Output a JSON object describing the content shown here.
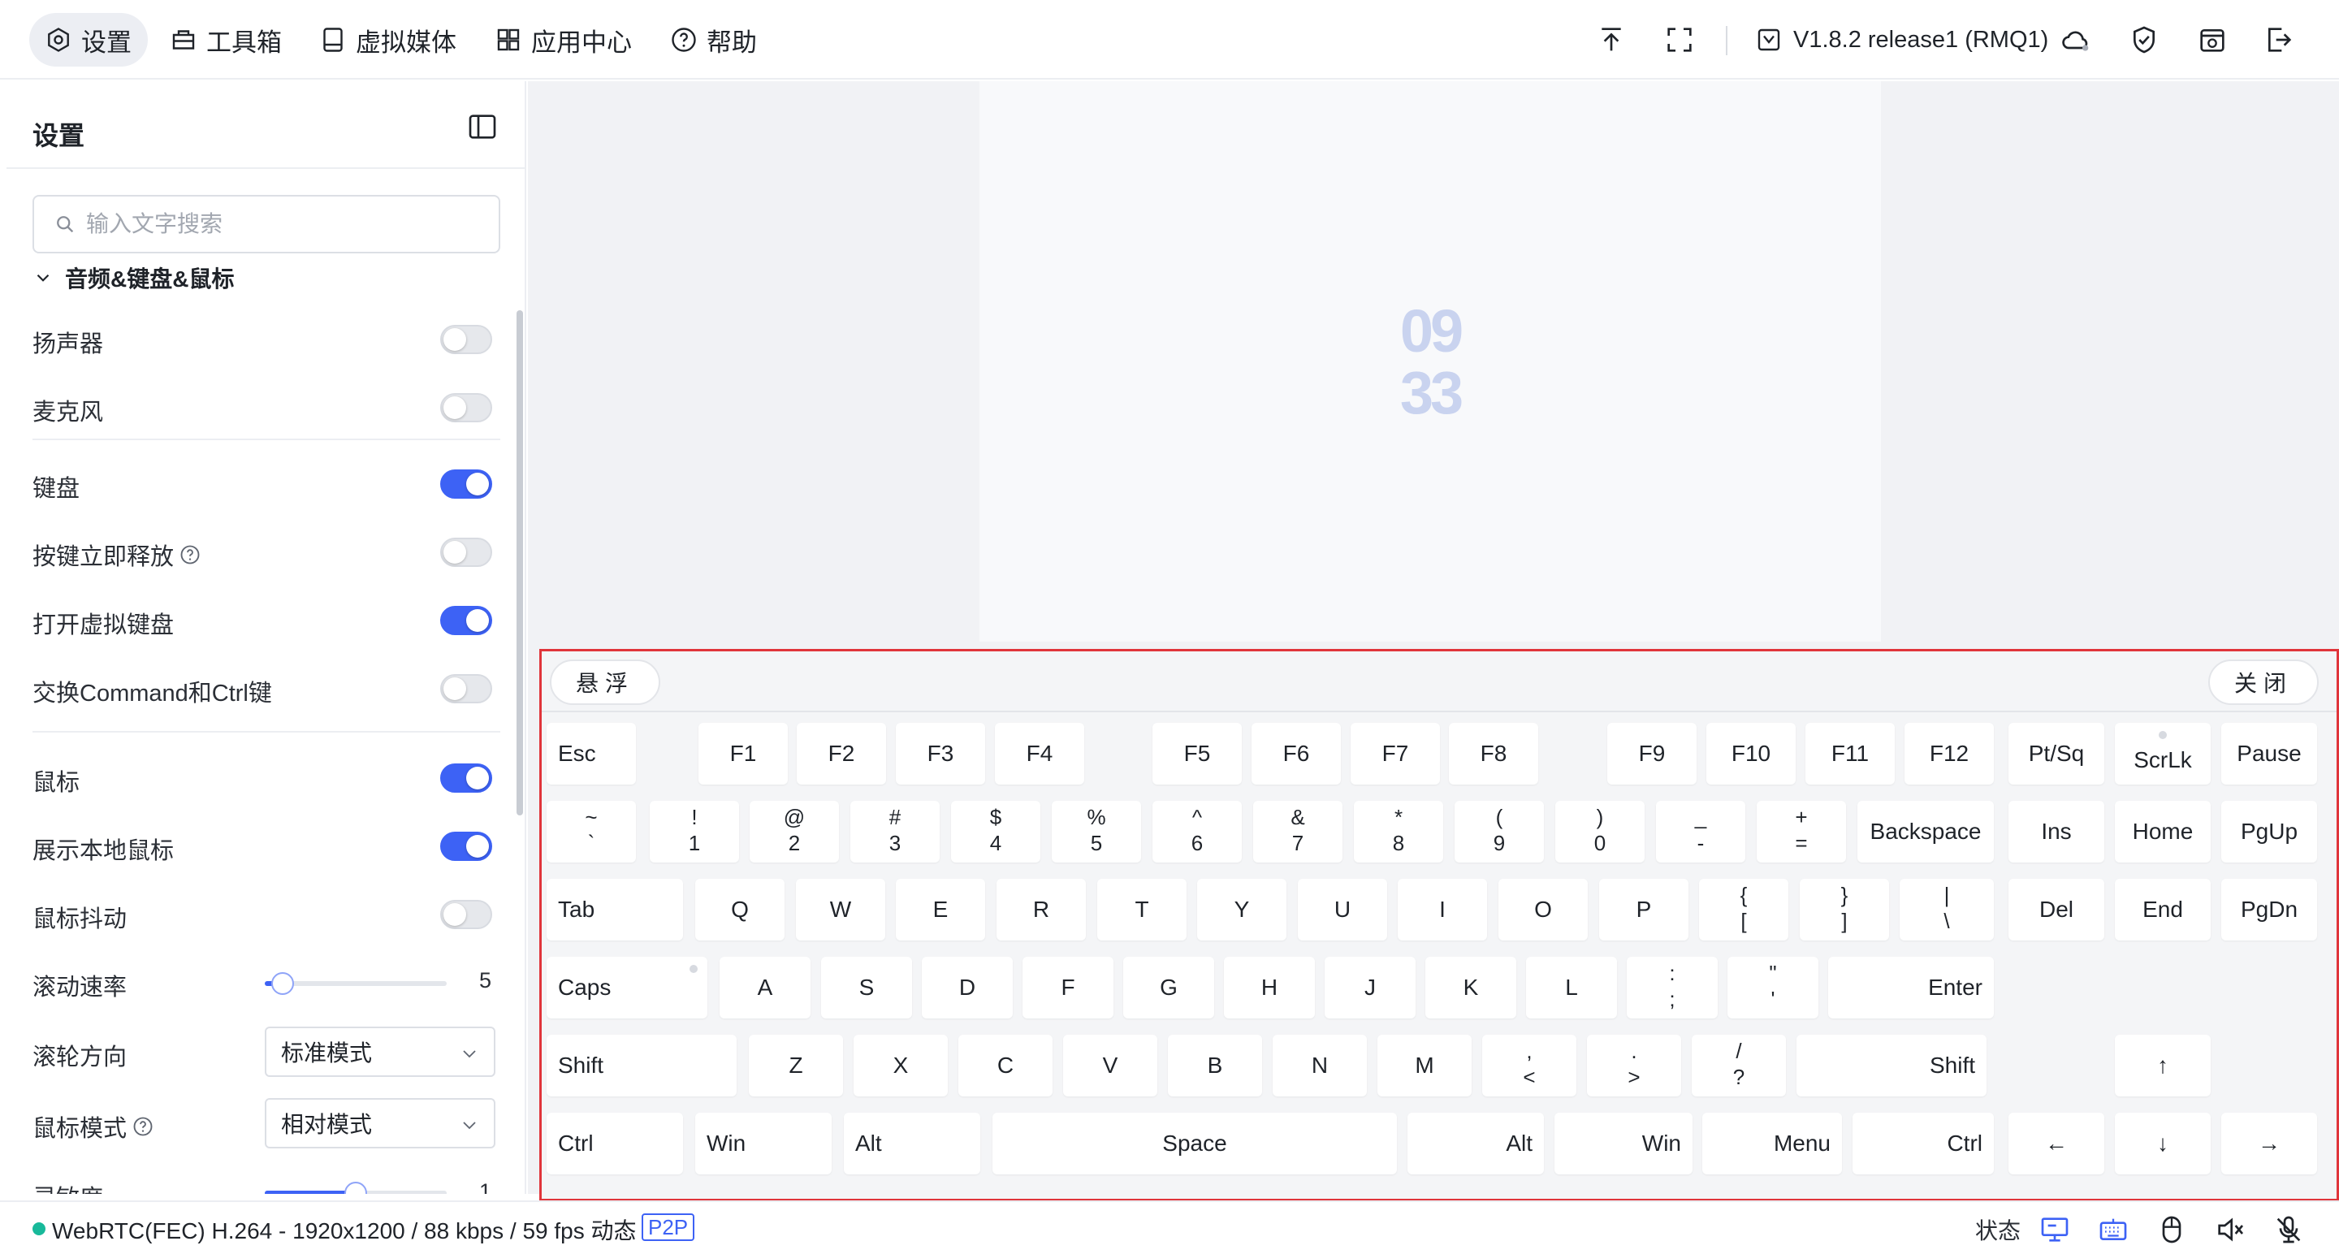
{
  "topbar": {
    "nav": [
      {
        "label": "设置",
        "icon": "gear-icon",
        "active": true
      },
      {
        "label": "工具箱",
        "icon": "toolbox-icon",
        "active": false
      },
      {
        "label": "虚拟媒体",
        "icon": "disk-icon",
        "active": false
      },
      {
        "label": "应用中心",
        "icon": "apps-icon",
        "active": false
      },
      {
        "label": "帮助",
        "icon": "help-icon",
        "active": false
      }
    ],
    "version": "V1.8.2 release1 (RMQ1)",
    "right_icons": [
      "upload-icon",
      "fullscreen-icon",
      "cloud-icon",
      "shield-check-icon",
      "window-icon",
      "logout-icon"
    ]
  },
  "sidebar": {
    "title": "设置",
    "search_placeholder": "输入文字搜索",
    "section": "音频&键盘&鼠标",
    "rows": [
      {
        "label": "扬声器",
        "type": "toggle",
        "on": false
      },
      {
        "label": "麦克风",
        "type": "toggle",
        "on": false
      },
      {
        "label": "键盘",
        "type": "toggle",
        "on": true
      },
      {
        "label": "按键立即释放",
        "type": "toggle",
        "on": false,
        "help": true
      },
      {
        "label": "打开虚拟键盘",
        "type": "toggle",
        "on": true
      },
      {
        "label": "交换Command和Ctrl键",
        "type": "toggle",
        "on": false
      },
      {
        "label": "鼠标",
        "type": "toggle",
        "on": true
      },
      {
        "label": "展示本地鼠标",
        "type": "toggle",
        "on": true
      },
      {
        "label": "鼠标抖动",
        "type": "toggle",
        "on": false
      },
      {
        "label": "滚动速率",
        "type": "slider",
        "value": "5",
        "fraction": 0.1
      },
      {
        "label": "滚轮方向",
        "type": "select",
        "value": "标准模式"
      },
      {
        "label": "鼠标模式",
        "type": "select",
        "value": "相对模式",
        "help": true
      },
      {
        "label": "灵敏度",
        "type": "slider",
        "value": "1",
        "fraction": 0.5
      }
    ]
  },
  "screen": {
    "clock_hour": "09",
    "clock_minute": "33"
  },
  "keyboard": {
    "float_label": "悬浮",
    "close_label": "关闭",
    "keys": [
      {
        "label": "Esc"
      },
      {
        "label": "F1"
      },
      {
        "label": "F2"
      },
      {
        "label": "F3"
      },
      {
        "label": "F4"
      },
      {
        "label": "F5"
      },
      {
        "label": "F6"
      },
      {
        "label": "F7"
      },
      {
        "label": "F8"
      },
      {
        "label": "F9"
      },
      {
        "label": "F10"
      },
      {
        "label": "F11"
      },
      {
        "label": "F12"
      },
      {
        "label": "Pt/Sq"
      },
      {
        "label": "ScrLk"
      },
      {
        "label": "Pause"
      },
      {
        "top": "~",
        "bot": "`"
      },
      {
        "top": "!",
        "bot": "1"
      },
      {
        "top": "@",
        "bot": "2"
      },
      {
        "top": "#",
        "bot": "3"
      },
      {
        "top": "$",
        "bot": "4"
      },
      {
        "top": "%",
        "bot": "5"
      },
      {
        "top": "^",
        "bot": "6"
      },
      {
        "top": "&",
        "bot": "7"
      },
      {
        "top": "*",
        "bot": "8"
      },
      {
        "top": "(",
        "bot": "9"
      },
      {
        "top": ")",
        "bot": "0"
      },
      {
        "top": "_",
        "bot": "-"
      },
      {
        "top": "+",
        "bot": "="
      },
      {
        "label": "Backspace"
      },
      {
        "label": "Ins"
      },
      {
        "label": "Home"
      },
      {
        "label": "PgUp"
      },
      {
        "label": "Tab"
      },
      {
        "label": "Q"
      },
      {
        "label": "W"
      },
      {
        "label": "E"
      },
      {
        "label": "R"
      },
      {
        "label": "T"
      },
      {
        "label": "Y"
      },
      {
        "label": "U"
      },
      {
        "label": "I"
      },
      {
        "label": "O"
      },
      {
        "label": "P"
      },
      {
        "top": "{",
        "bot": "["
      },
      {
        "top": "}",
        "bot": "]"
      },
      {
        "top": "|",
        "bot": "\\"
      },
      {
        "label": "Del"
      },
      {
        "label": "End"
      },
      {
        "label": "PgDn"
      },
      {
        "label": "Caps"
      },
      {
        "label": "A"
      },
      {
        "label": "S"
      },
      {
        "label": "D"
      },
      {
        "label": "F"
      },
      {
        "label": "G"
      },
      {
        "label": "H"
      },
      {
        "label": "J"
      },
      {
        "label": "K"
      },
      {
        "label": "L"
      },
      {
        "top": ":",
        "bot": ";"
      },
      {
        "top": "\"",
        "bot": "'"
      },
      {
        "label": "Enter"
      },
      {
        "label": "Shift"
      },
      {
        "label": "Z"
      },
      {
        "label": "X"
      },
      {
        "label": "C"
      },
      {
        "label": "V"
      },
      {
        "label": "B"
      },
      {
        "label": "N"
      },
      {
        "label": "M"
      },
      {
        "top": ",",
        "bot": "<"
      },
      {
        "top": ".",
        "bot": ">"
      },
      {
        "top": "/",
        "bot": "?"
      },
      {
        "label": "Shift"
      },
      {
        "label": "↑"
      },
      {
        "label": "Ctrl"
      },
      {
        "label": "Win"
      },
      {
        "label": "Alt"
      },
      {
        "label": "Space"
      },
      {
        "label": "Alt"
      },
      {
        "label": "Win"
      },
      {
        "label": "Menu"
      },
      {
        "label": "Ctrl"
      },
      {
        "label": "←"
      },
      {
        "label": "↓"
      },
      {
        "label": "→"
      }
    ]
  },
  "statusbar": {
    "stream_info": "WebRTC(FEC) H.264 - 1920x1200 / 88 kbps / 59 fps 动态",
    "connection": "P2P",
    "status_label": "状态",
    "indicator_color": "#18b99a",
    "icons": [
      "monitor-icon",
      "keyboard-icon",
      "mouse-icon",
      "speaker-muted-icon",
      "microphone-icon"
    ]
  },
  "colors": {
    "accent": "#3d62f5",
    "keyboard_border": "#e0353b"
  }
}
